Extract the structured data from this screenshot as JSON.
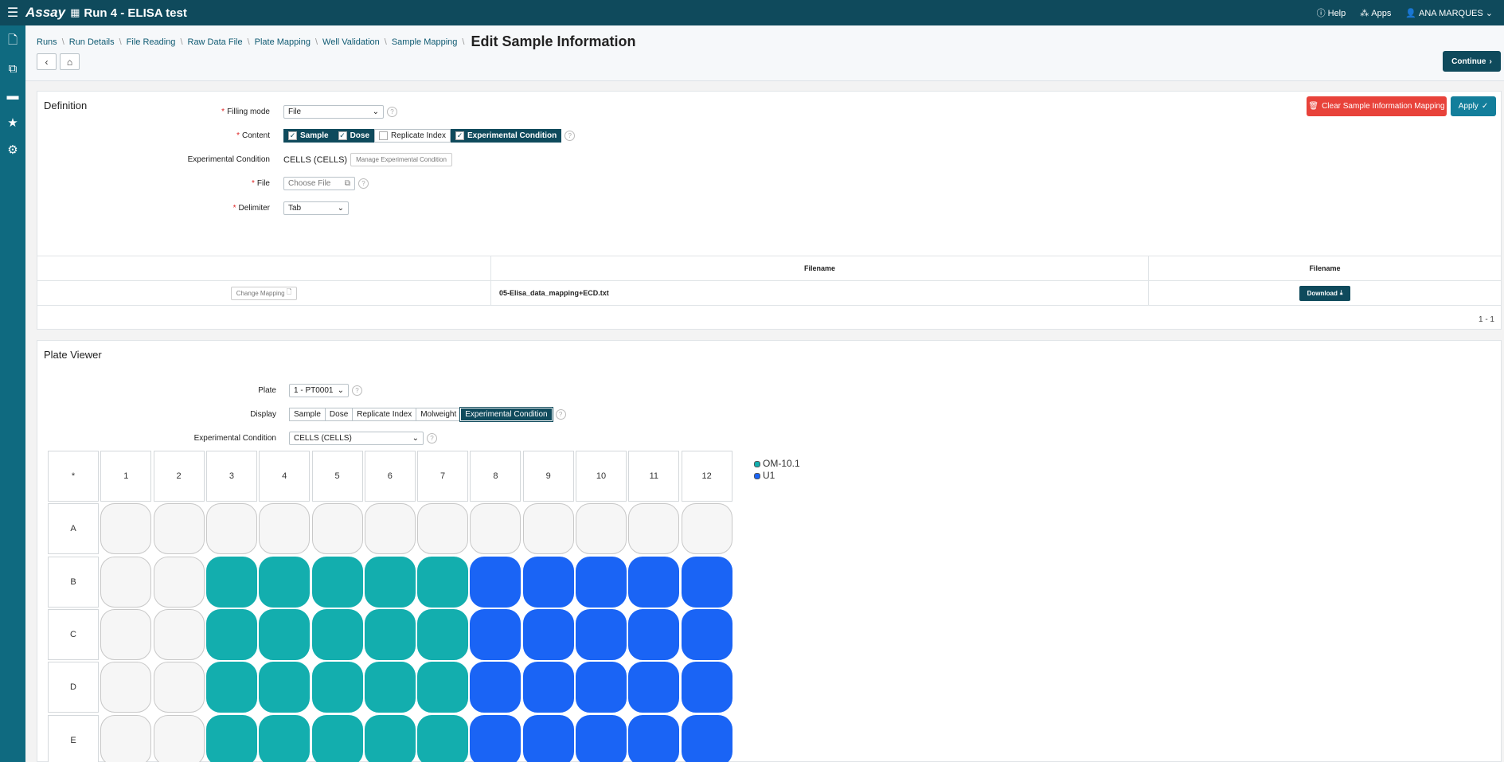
{
  "topbar": {
    "brand": "Assay",
    "run_title": "Run 4 - ELISA test",
    "help": "Help",
    "apps": "Apps",
    "user": "ANA MARQUES"
  },
  "breadcrumb": {
    "items": [
      "Runs",
      "Run Details",
      "File Reading",
      "Raw Data File",
      "Plate Mapping",
      "Well Validation",
      "Sample Mapping"
    ],
    "current": "Edit Sample Information"
  },
  "actions": {
    "continue": "Continue",
    "clear": "Clear Sample Information Mapping",
    "apply": "Apply"
  },
  "definition": {
    "title": "Definition",
    "filling_mode_label": "Filling mode",
    "filling_mode_value": "File",
    "content_label": "Content",
    "content_options": [
      {
        "label": "Sample",
        "checked": true
      },
      {
        "label": "Dose",
        "checked": true
      },
      {
        "label": "Replicate Index",
        "checked": false
      },
      {
        "label": "Experimental Condition",
        "checked": true
      }
    ],
    "exp_condition_label": "Experimental Condition",
    "exp_condition_value": "CELLS (CELLS)",
    "manage_button": "Manage Experimental Condition",
    "file_label": "File",
    "file_button": "Choose File",
    "delimiter_label": "Delimiter",
    "delimiter_value": "Tab"
  },
  "file_table": {
    "headers": [
      "",
      "Filename",
      "Filename"
    ],
    "row": {
      "change_mapping": "Change Mapping",
      "filename": "05-Elisa_data_mapping+ECD.txt",
      "download": "Download"
    },
    "pager": "1 - 1"
  },
  "plate_viewer": {
    "title": "Plate Viewer",
    "plate_label": "Plate",
    "plate_value": "1 - PT0001",
    "display_label": "Display",
    "display_options": [
      "Sample",
      "Dose",
      "Replicate Index",
      "Molweight",
      "Experimental Condition"
    ],
    "display_active": "Experimental Condition",
    "exp_condition_label": "Experimental Condition",
    "exp_condition_value": "CELLS (CELLS)",
    "corner": "*",
    "columns": [
      "1",
      "2",
      "3",
      "4",
      "5",
      "6",
      "7",
      "8",
      "9",
      "10",
      "11",
      "12"
    ],
    "rows": [
      "A",
      "B",
      "C",
      "D",
      "E"
    ],
    "wells": [
      [
        "empty",
        "empty",
        "empty",
        "empty",
        "empty",
        "empty",
        "empty",
        "empty",
        "empty",
        "empty",
        "empty",
        "empty"
      ],
      [
        "empty",
        "empty",
        "OM-10.1",
        "OM-10.1",
        "OM-10.1",
        "OM-10.1",
        "OM-10.1",
        "U1",
        "U1",
        "U1",
        "U1",
        "U1"
      ],
      [
        "empty",
        "empty",
        "OM-10.1",
        "OM-10.1",
        "OM-10.1",
        "OM-10.1",
        "OM-10.1",
        "U1",
        "U1",
        "U1",
        "U1",
        "U1"
      ],
      [
        "empty",
        "empty",
        "OM-10.1",
        "OM-10.1",
        "OM-10.1",
        "OM-10.1",
        "OM-10.1",
        "U1",
        "U1",
        "U1",
        "U1",
        "U1"
      ],
      [
        "empty",
        "empty",
        "OM-10.1",
        "OM-10.1",
        "OM-10.1",
        "OM-10.1",
        "OM-10.1",
        "U1",
        "U1",
        "U1",
        "U1",
        "U1"
      ]
    ],
    "legend": [
      {
        "name": "OM-10.1",
        "color": "#13aeae"
      },
      {
        "name": "U1",
        "color": "#1a64f5"
      }
    ],
    "empty_color": "#f6f6f6"
  }
}
